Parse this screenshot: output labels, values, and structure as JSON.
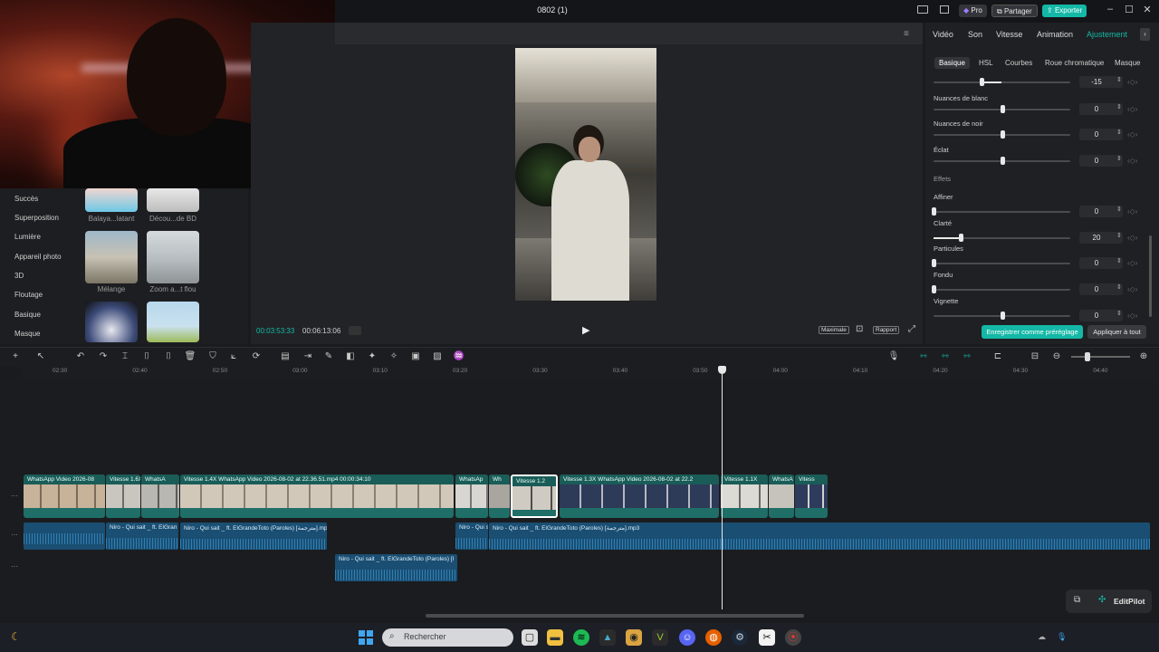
{
  "window": {
    "title": "0802 (1)",
    "pro_label": "Pro",
    "share_label": "Partager",
    "export_label": "Exporter"
  },
  "left_panel": {
    "categories": [
      "Succès",
      "Superposition",
      "Lumière",
      "Appareil photo",
      "3D",
      "Floutage",
      "Basique",
      "Masque"
    ],
    "thumbs": [
      "Balaya...latant",
      "Décou...de BD",
      "Mélange",
      "Zoom a...t flou"
    ]
  },
  "player": {
    "current_time": "00:03:53:33",
    "total_time": "00:06:13:06",
    "maximale_label": "Maximale",
    "rapport_label": "Rapport"
  },
  "right_panel": {
    "tabs": [
      "Vidéo",
      "Son",
      "Vitesse",
      "Animation",
      "Ajustement"
    ],
    "active_tab": "Ajustement",
    "subtabs": [
      "Basique",
      "HSL",
      "Courbes",
      "Roue chromatique",
      "Masque"
    ],
    "top_value": "-15",
    "section_effets": "Effets",
    "params": [
      {
        "label": "Nuances de blanc",
        "value": "0",
        "level": 0.5
      },
      {
        "label": "Nuances de noir",
        "value": "0",
        "level": 0.5
      },
      {
        "label": "Éclat",
        "value": "0",
        "level": 0.5
      },
      {
        "label": "Affiner",
        "value": "0",
        "level": 0.0
      },
      {
        "label": "Clarté",
        "value": "20",
        "level": 0.2
      },
      {
        "label": "Particules",
        "value": "0",
        "level": 0.0
      },
      {
        "label": "Fondu",
        "value": "0",
        "level": 0.0
      },
      {
        "label": "Vignette",
        "value": "0",
        "level": 0.5
      }
    ],
    "save_preset_label": "Enregistrer comme préréglage",
    "apply_all_label": "Appliquer à tout"
  },
  "ruler": [
    "02:30",
    "02:40",
    "02:50",
    "03:00",
    "03:10",
    "03:20",
    "03:30",
    "03:40",
    "03:50",
    "04:00",
    "04:10",
    "04:20",
    "04:30",
    "04:40"
  ],
  "video_clips": [
    "WhatsApp Video 2026-08",
    "Vitesse 1.6X",
    "WhatsA",
    "Vitesse 1.4X   WhatsApp Video 2026-08-02 at 22.36.51.mp4   00:00:34:10",
    "WhatsAp",
    "Wh",
    "Vitesse 1.2",
    "Vitesse 1.3X   WhatsApp Video 2026-08-02 at 22.2",
    "Vitesse 1.1X",
    "WhatsA",
    "Vitess"
  ],
  "audio_clips": [
    "Niro - Qui sait _ ft. ElGran",
    "Niro - Qui sait _ ft. ElGrandeToto (Paroles) [مترجمة].mp",
    "Niro - Qui s",
    "Niro - Qui sait _ ft. ElGrandeToto (Paroles) [مترجمة].mp3",
    "Niro - Qui sait _ ft. ElGrandeToto (Paroles) [I"
  ],
  "editpilot_label": "EditPilot",
  "taskbar": {
    "search_placeholder": "Rechercher"
  }
}
